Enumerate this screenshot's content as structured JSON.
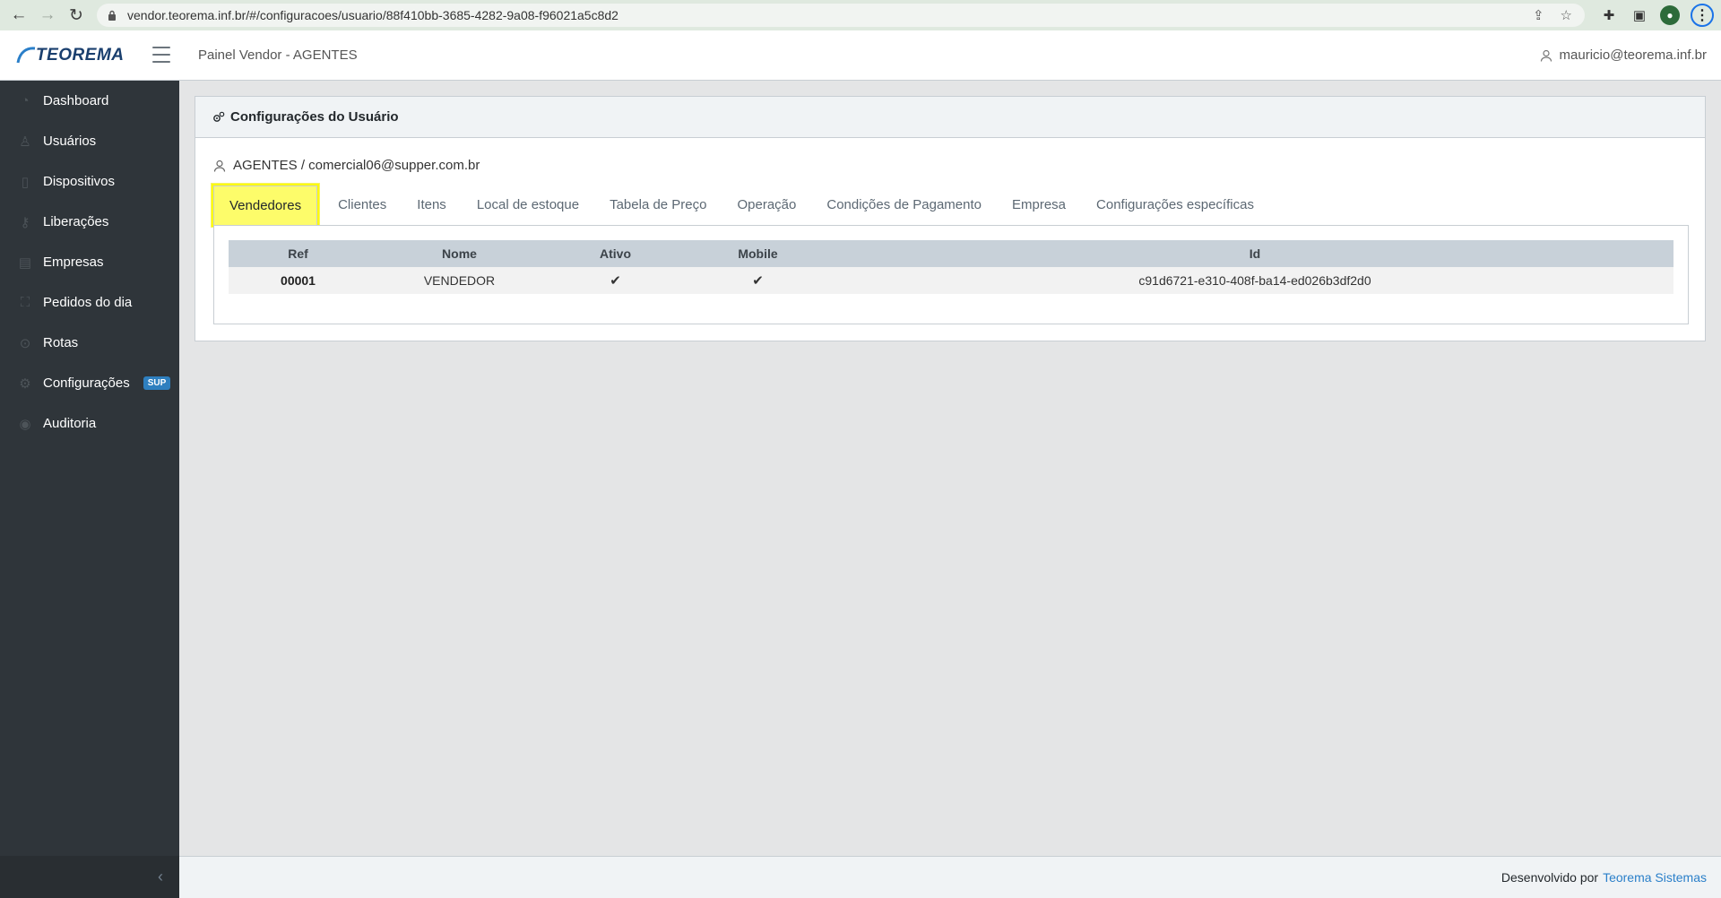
{
  "browser": {
    "url": "vendor.teorema.inf.br/#/configuracoes/usuario/88f410bb-3685-4282-9a08-f96021a5c8d2"
  },
  "header": {
    "logo_text": "TEOREMA",
    "panel_title": "Painel Vendor - AGENTES",
    "user_email": "mauricio@teorema.inf.br"
  },
  "sidebar": {
    "items": [
      {
        "label": "Dashboard",
        "icon": "speedometer-icon"
      },
      {
        "label": "Usuários",
        "icon": "user-icon"
      },
      {
        "label": "Dispositivos",
        "icon": "phone-icon"
      },
      {
        "label": "Liberações",
        "icon": "key-icon"
      },
      {
        "label": "Empresas",
        "icon": "building-icon"
      },
      {
        "label": "Pedidos do dia",
        "icon": "bag-icon"
      },
      {
        "label": "Rotas",
        "icon": "location-pin-icon"
      },
      {
        "label": "Configurações",
        "icon": "gear-icon",
        "badge": "SUP"
      },
      {
        "label": "Auditoria",
        "icon": "eye-icon"
      }
    ]
  },
  "card": {
    "title": "Configurações do Usuário",
    "user_line": "AGENTES / comercial06@supper.com.br"
  },
  "tabs": [
    {
      "label": "Vendedores",
      "active": true
    },
    {
      "label": "Clientes"
    },
    {
      "label": "Itens"
    },
    {
      "label": "Local de estoque"
    },
    {
      "label": "Tabela de Preço"
    },
    {
      "label": "Operação"
    },
    {
      "label": "Condições de Pagamento"
    },
    {
      "label": "Empresa"
    },
    {
      "label": "Configurações específicas"
    }
  ],
  "table": {
    "headers": {
      "ref": "Ref",
      "nome": "Nome",
      "ativo": "Ativo",
      "mobile": "Mobile",
      "id": "Id"
    },
    "rows": [
      {
        "ref": "00001",
        "nome": "VENDEDOR",
        "ativo": "✔",
        "mobile": "✔",
        "id": "c91d6721-e310-408f-ba14-ed026b3df2d0"
      }
    ]
  },
  "footer": {
    "text": "Desenvolvido por",
    "link": "Teorema Sistemas"
  },
  "colors": {
    "sidebar_bg": "#2f353a",
    "accent": "#2a7fc9",
    "highlight": "#fdfc6a"
  }
}
